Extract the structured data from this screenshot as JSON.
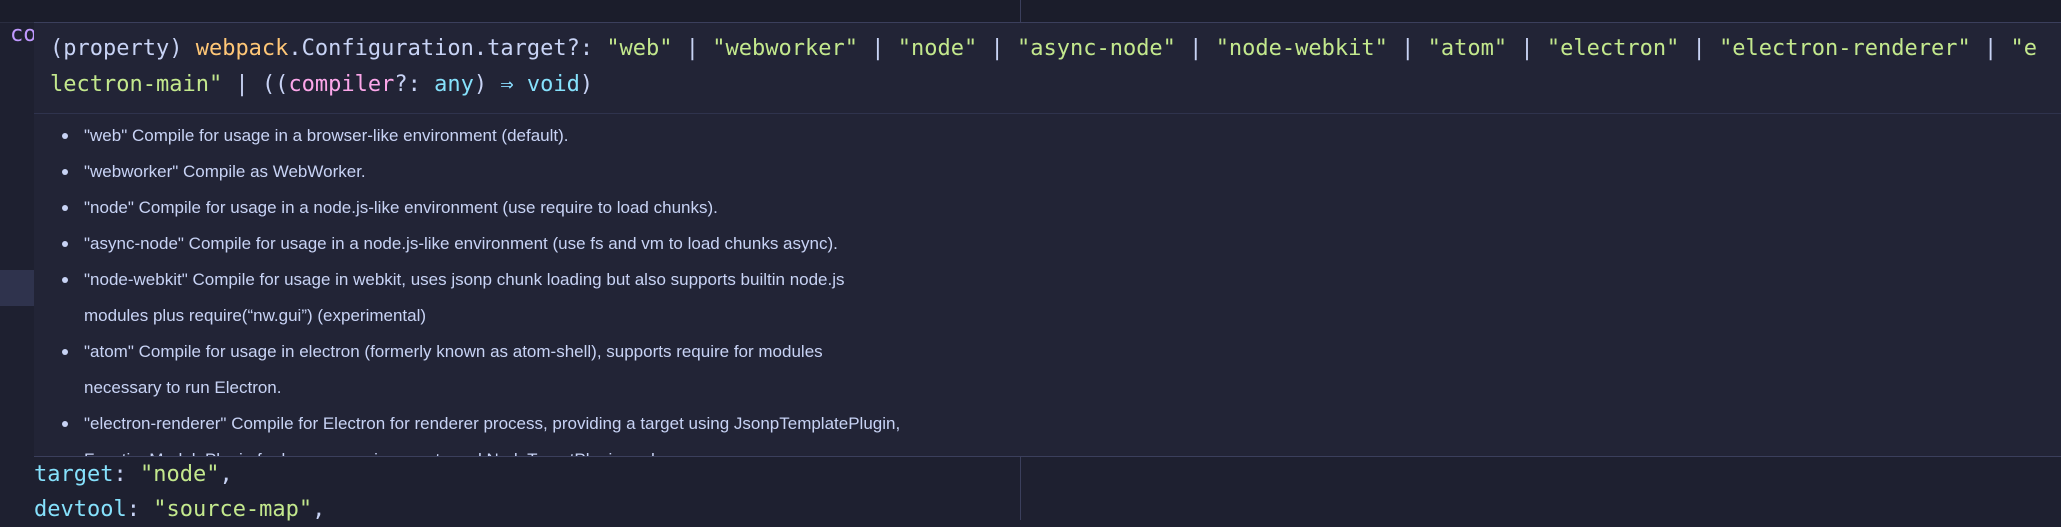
{
  "editor": {
    "partial_code": "co"
  },
  "hover": {
    "signature": {
      "prefix": "(property) ",
      "object": "webpack",
      "member": ".Configuration.target?: ",
      "options": [
        "\"web\"",
        "\"webworker\"",
        "\"node\"",
        "\"async-node\"",
        "\"node-webkit\"",
        "\"atom\"",
        "\"electron\"",
        "\"electron-renderer\"",
        "\"electron-main\""
      ],
      "separator": " | ",
      "fn_open": "((",
      "param": "compiler",
      "param_type": "?: ",
      "any_type": "any",
      "fn_close": ") ",
      "arrow": "⇒",
      "void_type": " void",
      "close": ")"
    },
    "doc_items": [
      "\"web\" Compile for usage in a browser-like environment (default).",
      "\"webworker\" Compile as WebWorker.",
      "\"node\" Compile for usage in a node.js-like environment (use require to load chunks).",
      "\"async-node\" Compile for usage in a node.js-like environment (use fs and vm to load chunks async).",
      "\"node-webkit\" Compile for usage in webkit, uses jsonp chunk loading but also supports builtin node.js modules plus require(“nw.gui”) (experimental)",
      "\"atom\" Compile for usage in electron (formerly known as atom-shell), supports require for modules necessary to run Electron.",
      "\"electron-renderer\" Compile for Electron for renderer process, providing a target using JsonpTemplatePlugin, FunctionModulePlugin for browser environments and NodeTargetPlugin and"
    ]
  },
  "code": {
    "line1": {
      "key": "target",
      "colon": ": ",
      "value": "\"node\"",
      "comma": ","
    },
    "line2": {
      "key": "devtool",
      "colon": ": ",
      "value": "\"source-map\"",
      "comma": ","
    }
  }
}
